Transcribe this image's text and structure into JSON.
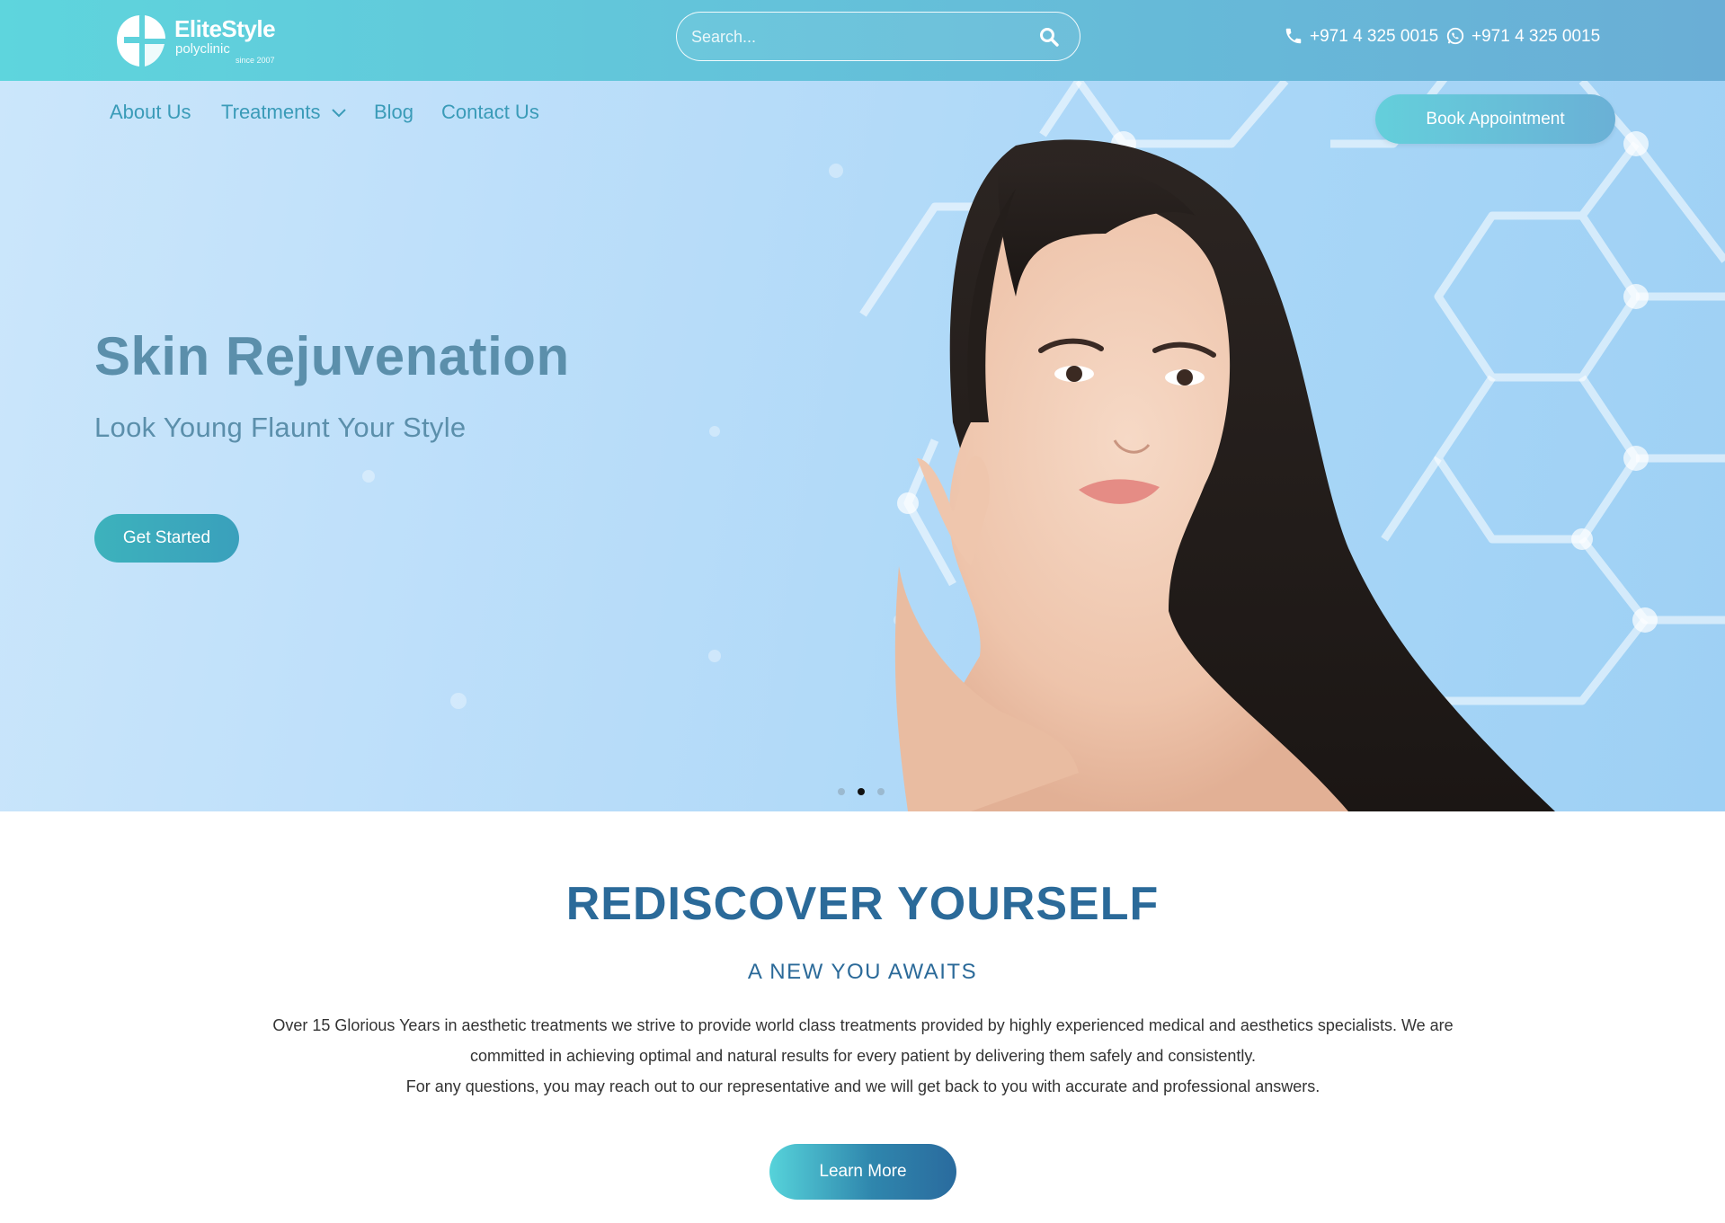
{
  "header": {
    "brand": "EliteStyle",
    "brand_sub": "polyclinic",
    "brand_since": "since 2007",
    "search_placeholder": "Search...",
    "phone": "+971 4 325 0015",
    "whatsapp": "+971 4 325 0015"
  },
  "nav": {
    "items": [
      "About Us",
      "Treatments",
      "Blog",
      "Contact Us"
    ],
    "book_label": "Book Appointment"
  },
  "hero": {
    "title": "Skin Rejuvenation",
    "subtitle": "Look Young Flaunt Your Style",
    "cta_label": "Get Started",
    "slide_count": 3,
    "active_slide": 2
  },
  "section": {
    "title": "REDISCOVER YOURSELF",
    "subtitle": "A NEW YOU AWAITS",
    "body_line1": "Over 15 Glorious Years in aesthetic treatments we strive to provide world class treatments provided by highly experienced medical and aesthetics specialists. We are committed in achieving optimal and natural results for every patient by delivering them safely and consistently.",
    "body_line2": "For any questions, you may reach out to our representative and we will get back to you with accurate and professional answers.",
    "learn_label": "Learn More"
  },
  "icons": {
    "search": "search-icon",
    "phone": "phone-icon",
    "whatsapp": "whatsapp-icon",
    "chevron": "chevron-down-icon"
  },
  "colors": {
    "topbar_start": "#5ed5dd",
    "topbar_end": "#6aaed6",
    "nav_text": "#3a9bb8",
    "hero_text": "#5b8fab",
    "heading_blue": "#2b6a99"
  }
}
